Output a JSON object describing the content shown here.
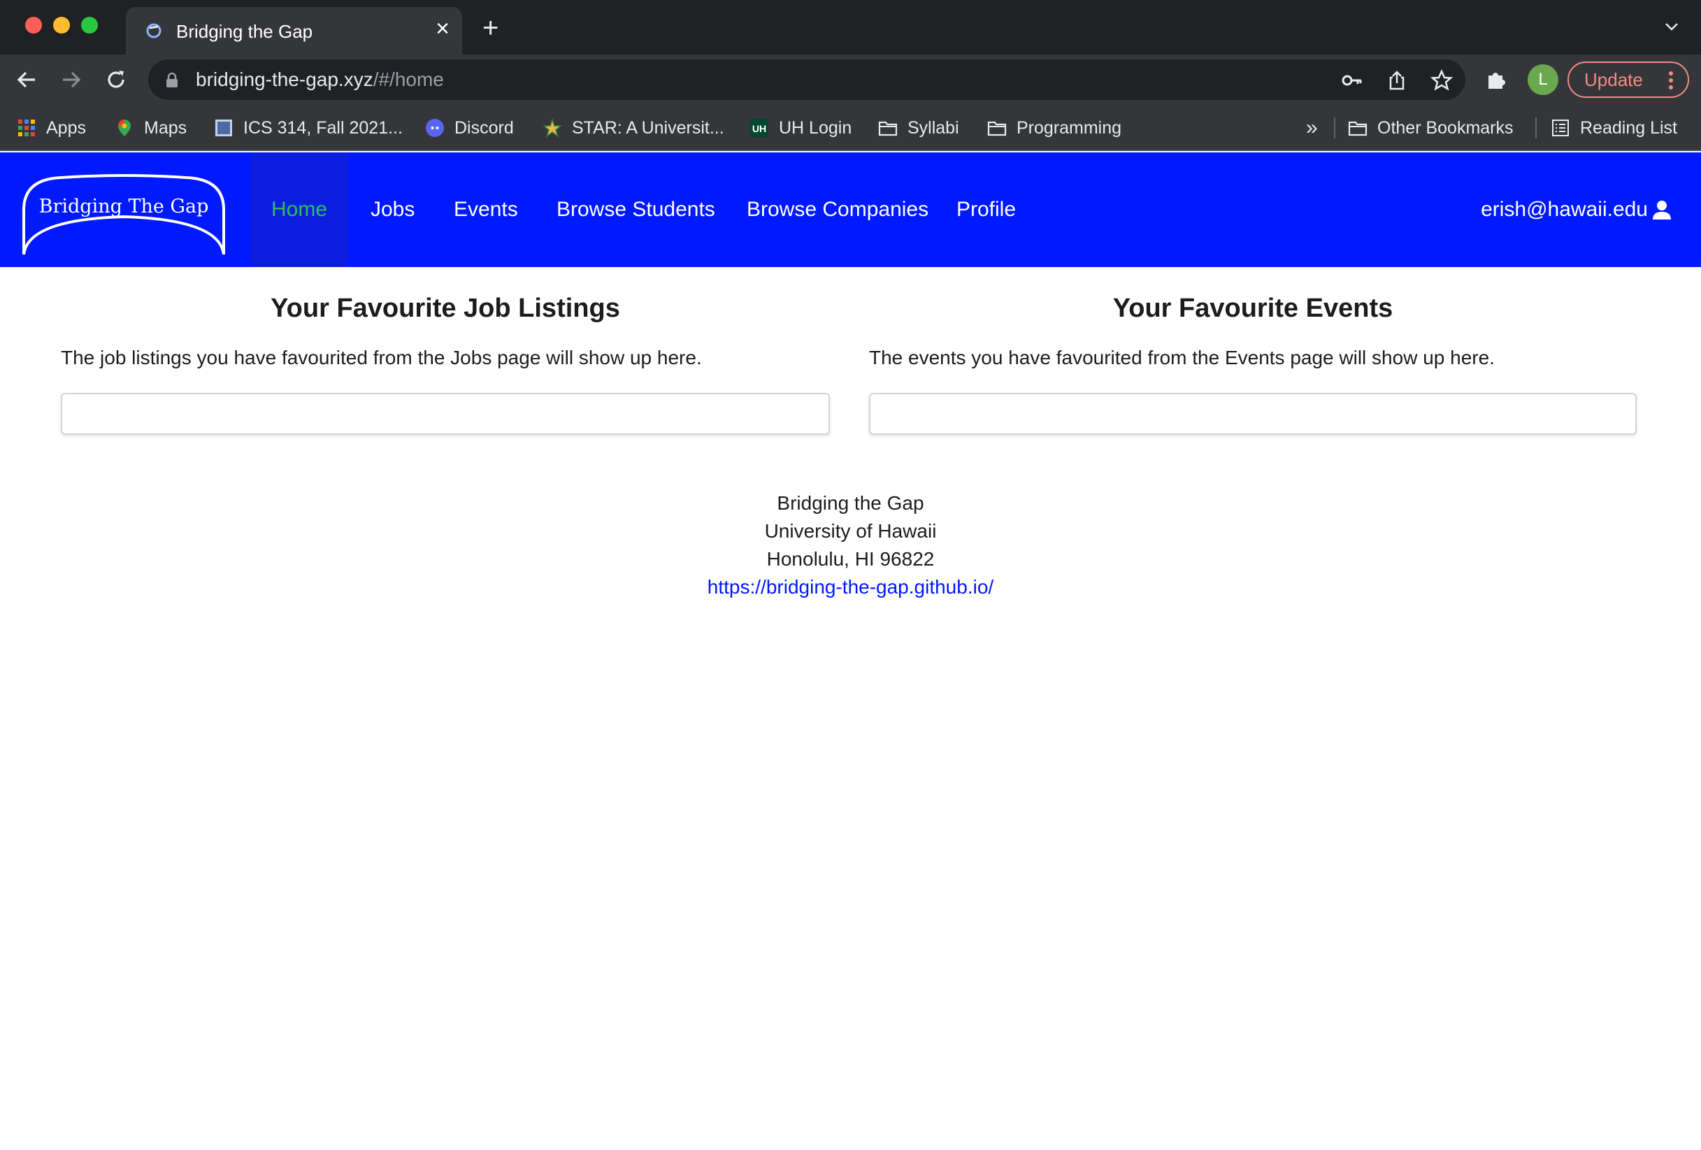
{
  "browser": {
    "tab_title": "Bridging the Gap",
    "url_host": "bridging-the-gap.xyz",
    "url_path": "/#/home",
    "profile_initial": "L",
    "update_label": "Update",
    "bookmarks": [
      {
        "label": "Apps",
        "icon": "apps-grid-icon"
      },
      {
        "label": "Maps",
        "icon": "maps-pin-icon"
      },
      {
        "label": "ICS 314, Fall 2021...",
        "icon": "page-icon"
      },
      {
        "label": "Discord",
        "icon": "discord-icon"
      },
      {
        "label": "STAR: A Universit...",
        "icon": "star-icon"
      },
      {
        "label": "UH Login",
        "icon": "uh-icon"
      },
      {
        "label": "Syllabi",
        "icon": "folder-icon"
      },
      {
        "label": "Programming",
        "icon": "folder-icon"
      }
    ],
    "overflow_label": "»",
    "other_bookmarks_label": "Other Bookmarks",
    "reading_list_label": "Reading List"
  },
  "navbar": {
    "brand": "Bridging The Gap",
    "items": [
      {
        "label": "Home",
        "active": true
      },
      {
        "label": "Jobs",
        "active": false
      },
      {
        "label": "Events",
        "active": false
      },
      {
        "label": "Browse Students",
        "active": false
      },
      {
        "label": "Browse Companies",
        "active": false
      },
      {
        "label": "Profile",
        "active": false
      }
    ],
    "user_email": "erish@hawaii.edu"
  },
  "main": {
    "jobs": {
      "title": "Your Favourite Job Listings",
      "description": "The job listings you have favourited from the Jobs page will show up here."
    },
    "events": {
      "title": "Your Favourite Events",
      "description": "The events you have favourited from the Events page will show up here."
    }
  },
  "footer": {
    "line1": "Bridging the Gap",
    "line2": "University of Hawaii",
    "line3": "Honolulu, HI 96822",
    "link": "https://bridging-the-gap.github.io/"
  },
  "colors": {
    "navbar_bg": "#0019ff",
    "active_nav": "#2ebd59",
    "link": "#0019ff",
    "chrome_dark": "#202124",
    "chrome_toolbar": "#35363a"
  }
}
